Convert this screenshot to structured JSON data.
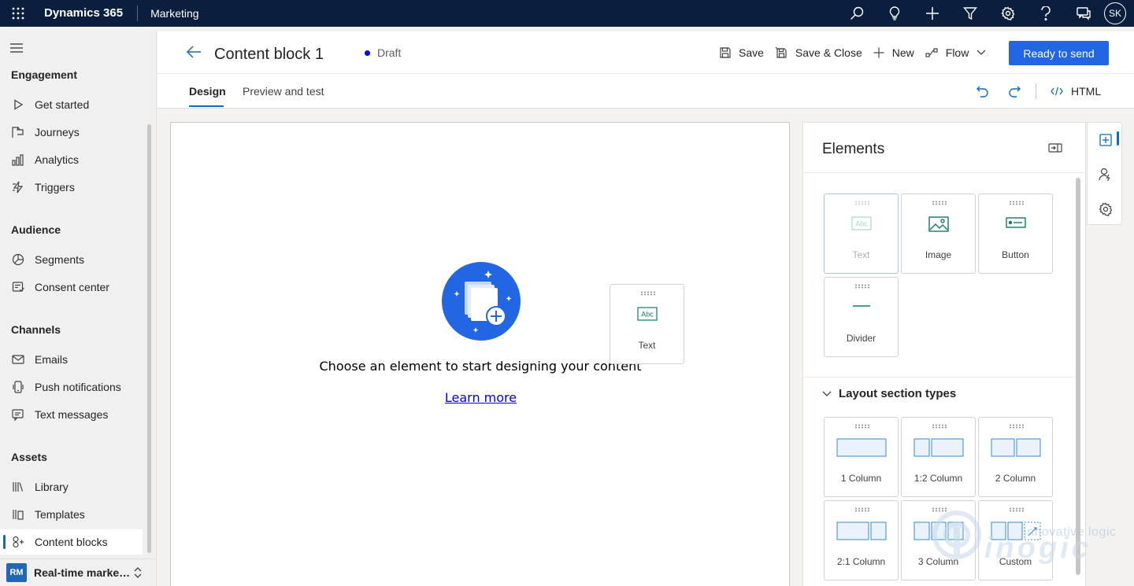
{
  "topbar": {
    "brand": "Dynamics 365",
    "app": "Marketing",
    "user_initials": "SK",
    "icons": [
      "search-icon",
      "lightbulb-icon",
      "plus-icon",
      "filter-icon",
      "gear-icon",
      "help-icon",
      "chat-icon"
    ]
  },
  "sidebar": {
    "groups": [
      {
        "title": "Engagement",
        "items": [
          {
            "label": "Get started",
            "icon": "play-icon"
          },
          {
            "label": "Journeys",
            "icon": "journey-icon"
          },
          {
            "label": "Analytics",
            "icon": "analytics-icon"
          },
          {
            "label": "Triggers",
            "icon": "trigger-icon"
          }
        ]
      },
      {
        "title": "Audience",
        "items": [
          {
            "label": "Segments",
            "icon": "segments-icon"
          },
          {
            "label": "Consent center",
            "icon": "consent-icon"
          }
        ]
      },
      {
        "title": "Channels",
        "items": [
          {
            "label": "Emails",
            "icon": "mail-icon"
          },
          {
            "label": "Push notifications",
            "icon": "phone-icon"
          },
          {
            "label": "Text messages",
            "icon": "sms-icon"
          }
        ]
      },
      {
        "title": "Assets",
        "items": [
          {
            "label": "Library",
            "icon": "library-icon"
          },
          {
            "label": "Templates",
            "icon": "templates-icon"
          },
          {
            "label": "Content blocks",
            "icon": "content-blocks-icon",
            "active": true
          }
        ]
      }
    ],
    "area": {
      "badge": "RM",
      "name": "Real-time marketing"
    }
  },
  "header": {
    "title": "Content block 1",
    "status": "Draft",
    "status_color": "#0000ff",
    "commands": {
      "save": "Save",
      "save_close": "Save & Close",
      "new": "New",
      "flow": "Flow"
    },
    "primary": "Ready to send",
    "primary_color": "#2266e3"
  },
  "tabs": {
    "design": "Design",
    "preview": "Preview and test",
    "html": "HTML"
  },
  "canvas": {
    "empty_message": "Choose an element to start designing your content",
    "learn_more": "Learn more",
    "drag_ghost_label": "Text"
  },
  "panel": {
    "title": "Elements",
    "elements": [
      {
        "label": "Text",
        "state": "disabled"
      },
      {
        "label": "Image"
      },
      {
        "label": "Button"
      },
      {
        "label": "Divider"
      }
    ],
    "layout_title": "Layout section types",
    "layouts": [
      {
        "label": "1 Column"
      },
      {
        "label": "1:2 Column"
      },
      {
        "label": "2 Column"
      },
      {
        "label": "2:1 Column"
      },
      {
        "label": "3 Column"
      },
      {
        "label": "Custom"
      }
    ]
  },
  "rail": {
    "icons": [
      "add-element-icon",
      "personalization-icon",
      "settings-icon"
    ]
  },
  "watermark": {
    "line1": "innovative logic",
    "line2": "inogic"
  }
}
